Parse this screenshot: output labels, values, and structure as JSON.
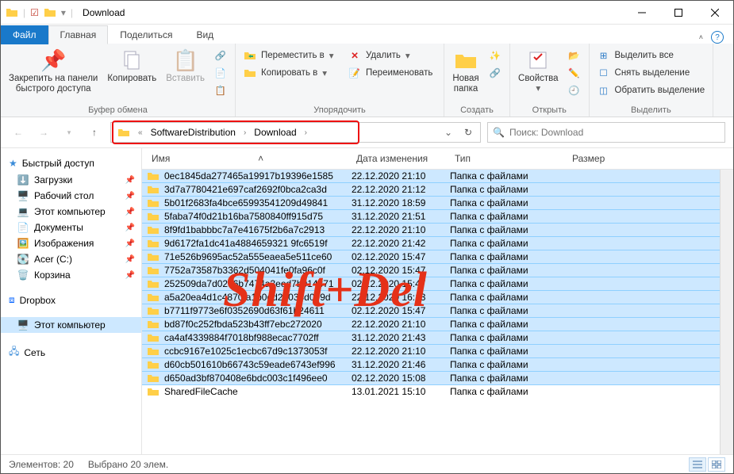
{
  "window": {
    "title": "Download"
  },
  "tabs": {
    "file": "Файл",
    "home": "Главная",
    "share": "Поделиться",
    "view": "Вид"
  },
  "ribbon": {
    "pin": "Закрепить на панели\nбыстрого доступа",
    "copy": "Копировать",
    "paste": "Вставить",
    "clipboard": "Буфер обмена",
    "moveTo": "Переместить в",
    "copyTo": "Копировать в",
    "delete": "Удалить",
    "rename": "Переименовать",
    "organize": "Упорядочить",
    "newFolder": "Новая\nпапка",
    "new": "Создать",
    "properties": "Свойства",
    "open": "Открыть",
    "selectAll": "Выделить все",
    "selectNone": "Снять выделение",
    "invertSel": "Обратить выделение",
    "select": "Выделить"
  },
  "address": {
    "seg1": "SoftwareDistribution",
    "seg2": "Download"
  },
  "search": {
    "placeholder": "Поиск: Download"
  },
  "tree": {
    "quick": "Быстрый доступ",
    "items": [
      {
        "icon": "download",
        "label": "Загрузки"
      },
      {
        "icon": "desktop",
        "label": "Рабочий стол"
      },
      {
        "icon": "pc",
        "label": "Этот компьютер"
      },
      {
        "icon": "doc",
        "label": "Документы"
      },
      {
        "icon": "img",
        "label": "Изображения"
      },
      {
        "icon": "disk",
        "label": "Acer (C:)"
      },
      {
        "icon": "bin",
        "label": "Корзина"
      }
    ],
    "dropbox": "Dropbox",
    "thisPc": "Этот компьютер",
    "network": "Сеть"
  },
  "columns": {
    "name": "Имя",
    "date": "Дата изменения",
    "type": "Тип",
    "size": "Размер"
  },
  "typeLabel": "Папка с файлами",
  "files": [
    {
      "name": "0ec1845da277465a19917b19396e1585",
      "date": "22.12.2020 21:10"
    },
    {
      "name": "3d7a7780421e697caf2692f0bca2ca3d",
      "date": "22.12.2020 21:12"
    },
    {
      "name": "5b01f2683fa4bce65993541209d49841",
      "date": "31.12.2020 18:59"
    },
    {
      "name": "5faba74f0d21b16ba7580840ff915d75",
      "date": "31.12.2020 21:51"
    },
    {
      "name": "8f9fd1babbbc7a7e41675f2b6a7c2913",
      "date": "22.12.2020 21:10"
    },
    {
      "name": "9d6172fa1dc41a4884659321 9fc6519f",
      "date": "22.12.2020 21:42"
    },
    {
      "name": "71e526b9695ac52a555eaea5e511ce60",
      "date": "02.12.2020 15:47"
    },
    {
      "name": "7752a73587b3362d504041fe0fa96c0f",
      "date": "02.12.2020 15:47"
    },
    {
      "name": "252509da7d0256b7474a3eed7b014371",
      "date": "02.12.2020 15:47"
    },
    {
      "name": "a5a20ea4d1c4870fa1b0dd22033d009d",
      "date": "22.12.2020 16:13"
    },
    {
      "name": "b7711f9773e6f0352690d63f61b24611",
      "date": "02.12.2020 15:47"
    },
    {
      "name": "bd87f0c252fbda523b43ff7ebc272020",
      "date": "22.12.2020 21:10"
    },
    {
      "name": "ca4af4339884f7018bf988ecac7702ff",
      "date": "31.12.2020 21:43"
    },
    {
      "name": "ccbc9167e1025c1ecbc67d9c1373053f",
      "date": "22.12.2020 21:10"
    },
    {
      "name": "d60cb501610b66743c59eade6743ef996",
      "date": "31.12.2020 21:46"
    },
    {
      "name": "d650ad3bf870408e6bdc003c1f496ee0",
      "date": "02.12.2020 15:08"
    },
    {
      "name": "SharedFileCache",
      "date": "13.01.2021 15:10",
      "unsel": true
    }
  ],
  "status": {
    "items": "Элементов: 20",
    "selected": "Выбрано 20 элем."
  },
  "overlay": "Shift+Del"
}
